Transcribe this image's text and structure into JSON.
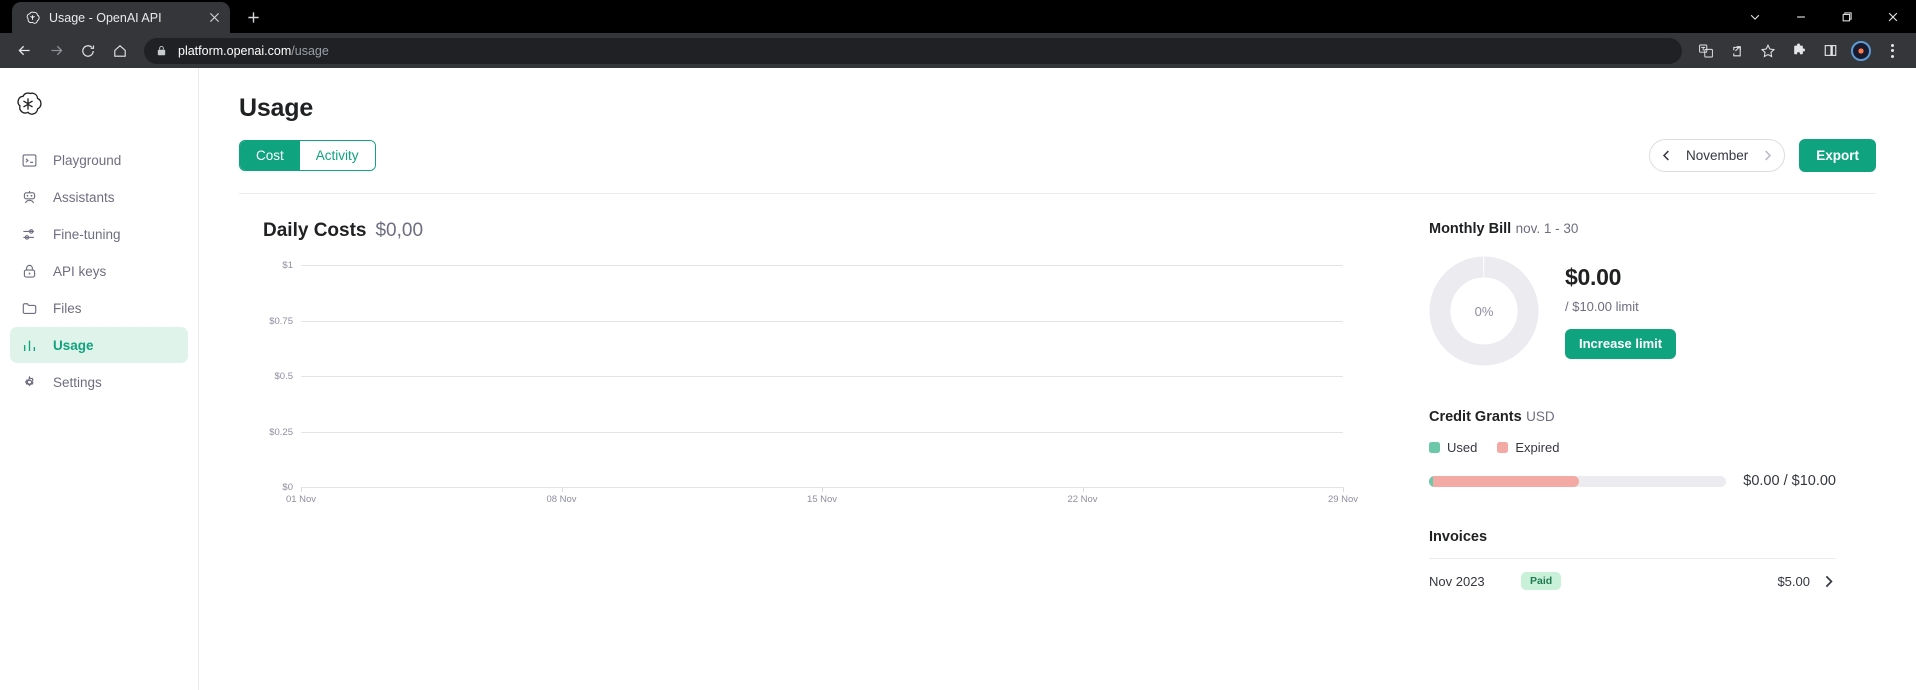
{
  "browser": {
    "tab": {
      "title": "Usage - OpenAI API",
      "favicon": "openai-logo-icon",
      "close": "×"
    },
    "new_tab_label": "+",
    "window_controls": {
      "tab_search": "tab-search-chevron-icon",
      "minimize": "minimize-icon",
      "maximize": "maximize-icon",
      "close": "close-icon"
    },
    "nav": {
      "back": "back-arrow-icon",
      "forward": "forward-arrow-icon",
      "reload": "reload-icon",
      "home": "home-icon"
    },
    "omnibox": {
      "lock": "lock-icon",
      "domain": "platform.openai.com",
      "path": "/usage"
    },
    "toolbar_icons": [
      "translate-icon",
      "share-icon",
      "bookmark-star-icon",
      "extensions-puzzle-icon",
      "side-panel-icon",
      "profile-avatar-icon",
      "chrome-menu-icon"
    ]
  },
  "sidebar": {
    "logo": "openai-logo-icon",
    "items": [
      {
        "label": "Playground",
        "icon": "terminal-icon",
        "active": false
      },
      {
        "label": "Assistants",
        "icon": "robot-icon",
        "active": false
      },
      {
        "label": "Fine-tuning",
        "icon": "sliders-icon",
        "active": false
      },
      {
        "label": "API keys",
        "icon": "lock-icon",
        "active": false
      },
      {
        "label": "Files",
        "icon": "folder-icon",
        "active": false
      },
      {
        "label": "Usage",
        "icon": "bar-chart-icon",
        "active": true
      },
      {
        "label": "Settings",
        "icon": "gear-icon",
        "active": false
      }
    ]
  },
  "header": {
    "title": "Usage",
    "tabs": [
      {
        "label": "Cost",
        "selected": true
      },
      {
        "label": "Activity",
        "selected": false
      }
    ],
    "month_selector": {
      "label": "November",
      "prev": "chevron-left-icon",
      "next": "chevron-right-icon"
    },
    "export_label": "Export"
  },
  "chart_data": {
    "type": "bar",
    "title": "Daily Costs",
    "amount": "$0,00",
    "xlabel": "",
    "ylabel": "",
    "ylim": [
      0,
      1
    ],
    "grid": true,
    "legend": "none",
    "categories": [
      "01 Nov",
      "08 Nov",
      "15 Nov",
      "22 Nov",
      "29 Nov"
    ],
    "ytick_labels": [
      "$1",
      "$0.75",
      "$0.5",
      "$0.25",
      "$0"
    ],
    "ytick_values": [
      1,
      0.75,
      0.5,
      0.25,
      0
    ],
    "values": [
      0,
      0,
      0,
      0,
      0
    ],
    "series": [
      {
        "name": "Daily Cost",
        "values": [
          0,
          0,
          0,
          0,
          0
        ]
      }
    ]
  },
  "monthly_bill": {
    "title": "Monthly Bill",
    "subtitle": "nov. 1 - 30",
    "percent_label": "0%",
    "percent_value": 0,
    "amount": "$0.00",
    "limit_text": "/ $10.00 limit",
    "increase_button": "Increase limit",
    "donut_track_color": "#ebebf0",
    "donut_fill_color": "#10a37f"
  },
  "credit_grants": {
    "title": "Credit Grants",
    "currency": "USD",
    "legend": [
      {
        "label": "Used",
        "color": "#6cc8a8"
      },
      {
        "label": "Expired",
        "color": "#f4aaa4"
      }
    ],
    "used_percent": 1.5,
    "expired_percent": 49,
    "value_label": "$0.00 / $10.00"
  },
  "invoices": {
    "title": "Invoices",
    "rows": [
      {
        "date": "Nov 2023",
        "status": "Paid",
        "amount": "$5.00",
        "chevron": "chevron-right-icon"
      }
    ]
  },
  "theme": {
    "accent": "#10a37f",
    "accent_bg": "#dff3ea",
    "text": "#202123",
    "muted": "#6e6e80"
  }
}
